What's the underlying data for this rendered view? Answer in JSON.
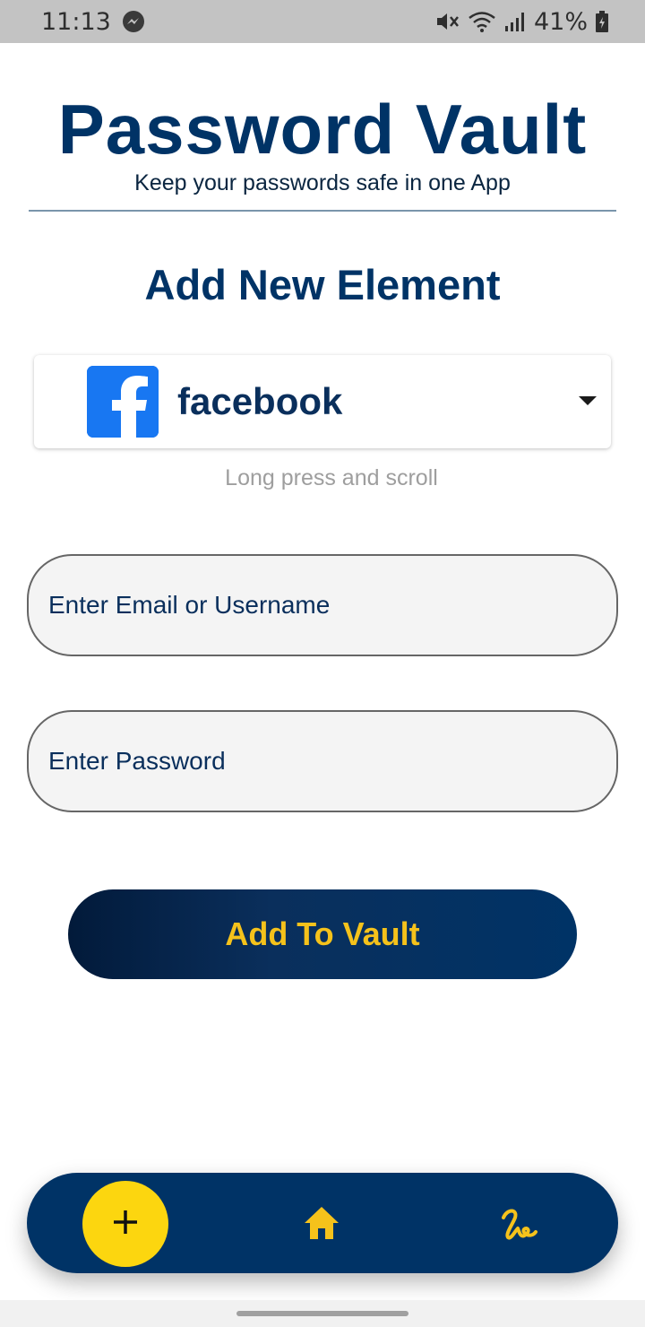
{
  "status_bar": {
    "time": "11:13",
    "battery": "41%",
    "icons": [
      "messenger-icon",
      "mute-icon",
      "wifi-icon",
      "signal-icon",
      "battery-icon"
    ]
  },
  "header": {
    "title": "Password Vault",
    "subtitle": "Keep your passwords safe in one App"
  },
  "form": {
    "section_title": "Add New Element",
    "platform": {
      "selected": "facebook",
      "icon": "facebook-logo-icon",
      "hint": "Long press and scroll"
    },
    "email": {
      "placeholder": "Enter Email or Username",
      "value": ""
    },
    "password": {
      "placeholder": "Enter Password",
      "value": ""
    },
    "submit_label": "Add To Vault"
  },
  "bottom_nav": {
    "items": [
      {
        "name": "add",
        "icon": "plus-icon",
        "active": true
      },
      {
        "name": "home",
        "icon": "home-icon"
      },
      {
        "name": "signature",
        "icon": "signature-icon"
      }
    ]
  },
  "colors": {
    "primary": "#003366",
    "accent": "#fcd60f",
    "button_text": "#f5c21b",
    "facebook_blue": "#1877f2"
  }
}
